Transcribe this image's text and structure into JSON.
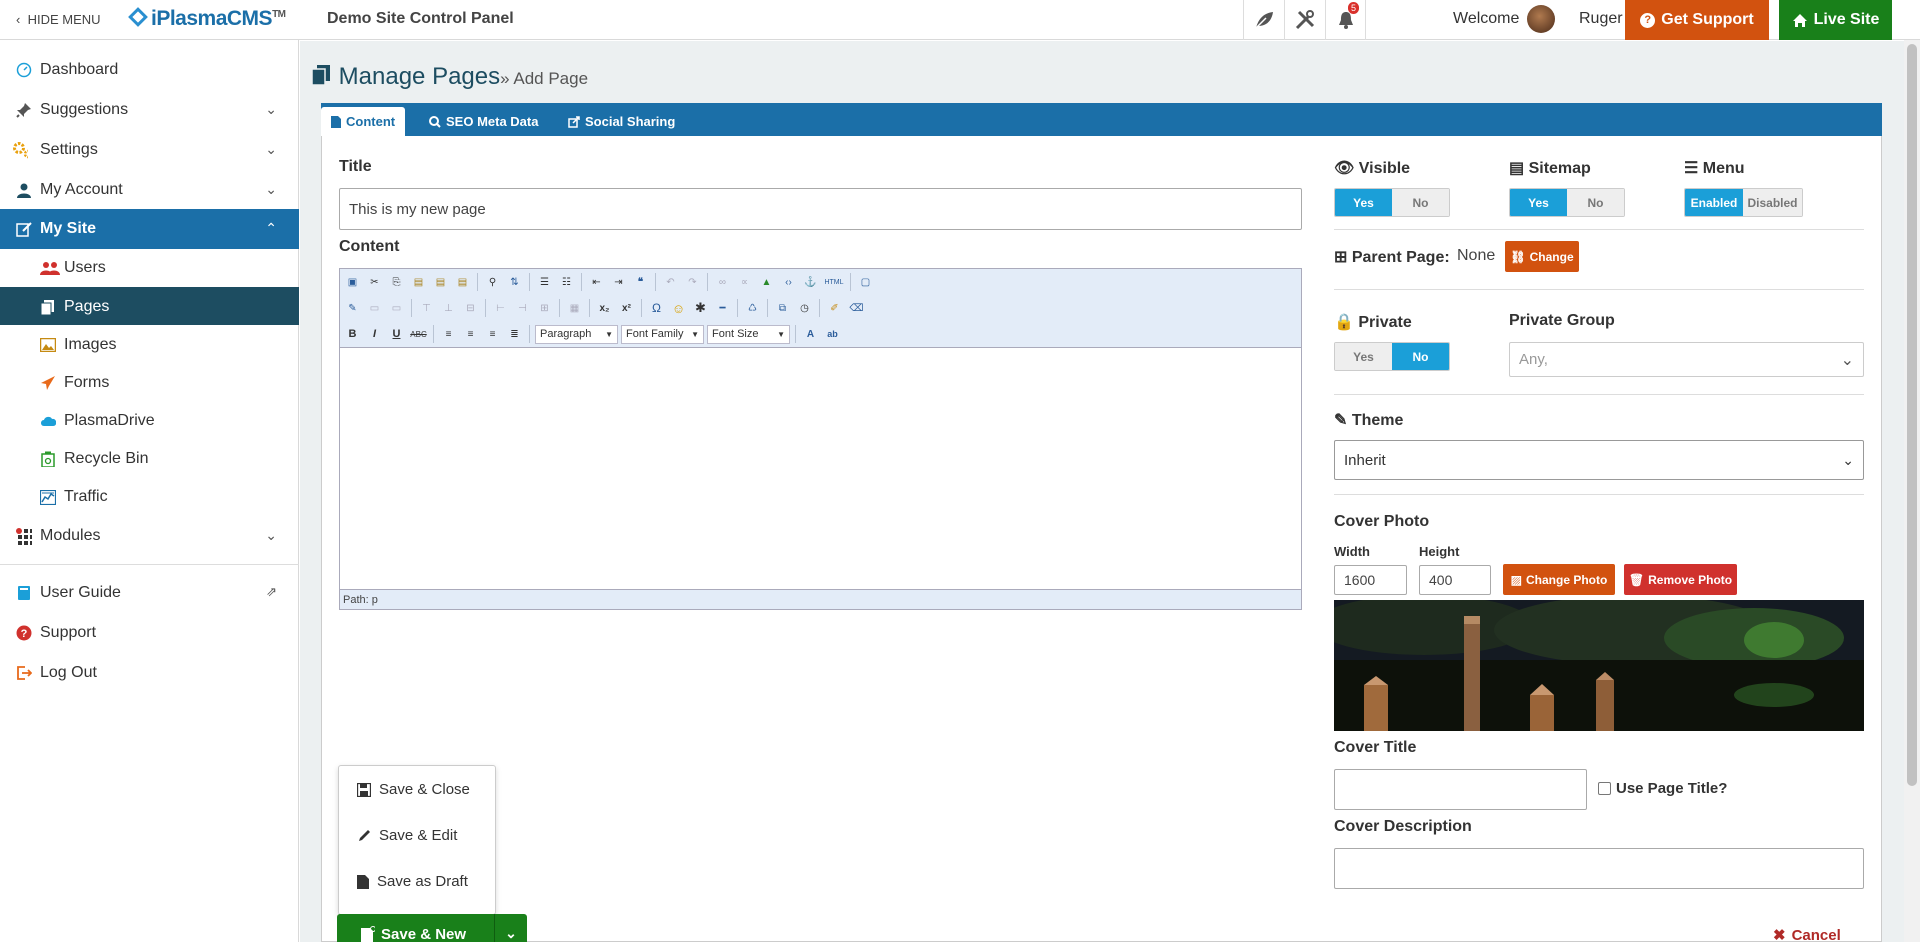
{
  "topbar": {
    "hide_menu": "HIDE MENU",
    "logo": "iPlasmaCMS",
    "logo_tm": "TM",
    "panel_title": "Demo Site Control Panel",
    "notification_count": "5",
    "welcome": "Welcome",
    "user_name": "Ruger",
    "get_support": "Get Support",
    "live_site": "Live Site"
  },
  "sidebar": {
    "items": [
      {
        "label": "Dashboard",
        "icon": "dashboard-icon"
      },
      {
        "label": "Suggestions",
        "icon": "pin-icon"
      },
      {
        "label": "Settings",
        "icon": "gears-icon"
      },
      {
        "label": "My Account",
        "icon": "user-icon"
      },
      {
        "label": "My Site",
        "icon": "edit-icon"
      },
      {
        "label": "Users",
        "icon": "users-icon"
      },
      {
        "label": "Pages",
        "icon": "pages-icon"
      },
      {
        "label": "Images",
        "icon": "image-icon"
      },
      {
        "label": "Forms",
        "icon": "paper-plane-icon"
      },
      {
        "label": "PlasmaDrive",
        "icon": "cloud-icon"
      },
      {
        "label": "Recycle Bin",
        "icon": "recycle-icon"
      },
      {
        "label": "Traffic",
        "icon": "chart-icon"
      },
      {
        "label": "Modules",
        "icon": "modules-icon"
      },
      {
        "label": "User Guide",
        "icon": "book-icon"
      },
      {
        "label": "Support",
        "icon": "question-icon"
      },
      {
        "label": "Log Out",
        "icon": "logout-icon"
      }
    ]
  },
  "header": {
    "title": "Manage Pages",
    "crumb": "» Add Page"
  },
  "tabs": [
    {
      "label": "Content"
    },
    {
      "label": "SEO Meta Data"
    },
    {
      "label": "Social Sharing"
    }
  ],
  "form": {
    "title_label": "Title",
    "title_value": "This is my new page",
    "content_label": "Content",
    "editor": {
      "paragraph": "Paragraph",
      "font_family": "Font Family",
      "font_size": "Font Size",
      "path": "Path: p",
      "html": "HTML"
    },
    "visible_label": "Visible",
    "sitemap_label": "Sitemap",
    "menu_label": "Menu",
    "yes": "Yes",
    "no": "No",
    "enabled": "Enabled",
    "disabled": "Disabled",
    "parent_page_label": "Parent Page:",
    "parent_page_value": "None",
    "change": "Change",
    "private_label": "Private",
    "private_group_label": "Private Group",
    "private_group_placeholder": "Any,",
    "theme_label": "Theme",
    "theme_value": "Inherit",
    "cover_photo_label": "Cover Photo",
    "width_label": "Width",
    "height_label": "Height",
    "width_value": "1600",
    "height_value": "400",
    "change_photo": "Change Photo",
    "remove_photo": "Remove Photo",
    "cover_title_label": "Cover Title",
    "use_page_title": "Use Page Title?",
    "cover_description_label": "Cover Description",
    "cancel": "Cancel"
  },
  "save_menu": {
    "items": [
      "Save & Close",
      "Save & Edit",
      "Save as Draft"
    ],
    "main": "Save & New"
  },
  "colors": {
    "primary": "#1b6fa8",
    "dark_nav": "#1d4d61",
    "orange": "#d2520f",
    "green": "#19801a",
    "toggle_on": "#1b9fd8",
    "red": "#d0312d"
  }
}
